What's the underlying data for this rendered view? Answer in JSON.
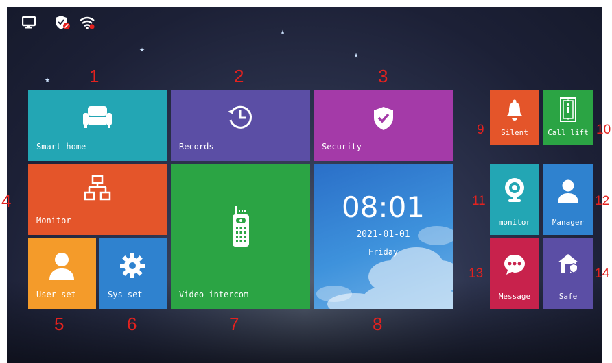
{
  "status_bar": {
    "icons": [
      "monitor-icon",
      "shield-alert-icon",
      "wifi-icon"
    ]
  },
  "tiles": {
    "smart_home": {
      "label": "Smart home",
      "icon": "sofa-icon",
      "color": "#23a6b4"
    },
    "records": {
      "label": "Records",
      "icon": "history-icon",
      "color": "#5b4ea5"
    },
    "security": {
      "label": "Security",
      "icon": "shield-check-icon",
      "color": "#a43aa8"
    },
    "monitor": {
      "label": "Monitor",
      "icon": "network-icon",
      "color": "#e4552a"
    },
    "user_set": {
      "label": "User set",
      "icon": "user-icon",
      "color": "#f49b2a"
    },
    "sys_set": {
      "label": "Sys set",
      "icon": "gear-icon",
      "color": "#2f82cf"
    },
    "video_intercom": {
      "label": "Video intercom",
      "icon": "walkie-talkie-icon",
      "color": "#2ba444"
    },
    "clock": {
      "time": "08:01",
      "date": "2021-01-01",
      "weekday": "Friday",
      "color": "#3d8fd6"
    },
    "silent": {
      "label": "Silent",
      "icon": "bell-icon",
      "color": "#e4552a"
    },
    "call_lift": {
      "label": "Call lift",
      "icon": "elevator-icon",
      "color": "#2ba444"
    },
    "cam_monitor": {
      "label": "monitor",
      "icon": "camera-icon",
      "color": "#23a6b4"
    },
    "manager": {
      "label": "Manager",
      "icon": "user-icon",
      "color": "#2f82cf"
    },
    "message": {
      "label": "Message",
      "icon": "chat-icon",
      "color": "#c8224c"
    },
    "safe": {
      "label": "Safe",
      "icon": "home-shield-icon",
      "color": "#5b4ea5"
    }
  },
  "callouts": [
    "1",
    "2",
    "3",
    "4",
    "5",
    "6",
    "7",
    "8",
    "9",
    "10",
    "11",
    "12",
    "13",
    "14"
  ]
}
